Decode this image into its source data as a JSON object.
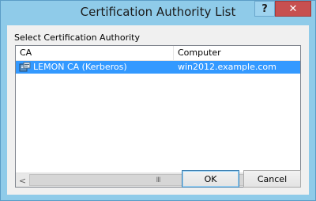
{
  "window": {
    "title": "Certification Authority List",
    "help_label": "?",
    "close_label": "✕"
  },
  "dialog": {
    "prompt": "Select Certification Authority"
  },
  "list": {
    "columns": [
      "CA",
      "Computer"
    ],
    "rows": [
      {
        "ca": "LEMON CA (Kerberos)",
        "computer": "win2012.example.com",
        "icon": "certificate-authority-icon",
        "selected": true
      }
    ],
    "scroll_left": "<",
    "scroll_right": ">",
    "scroll_grip": "III"
  },
  "buttons": {
    "ok_label": "OK",
    "cancel_label": "Cancel"
  },
  "colors": {
    "selection": "#3399ff",
    "titlebar": "#8fcbe9",
    "close_button": "#c75050"
  }
}
